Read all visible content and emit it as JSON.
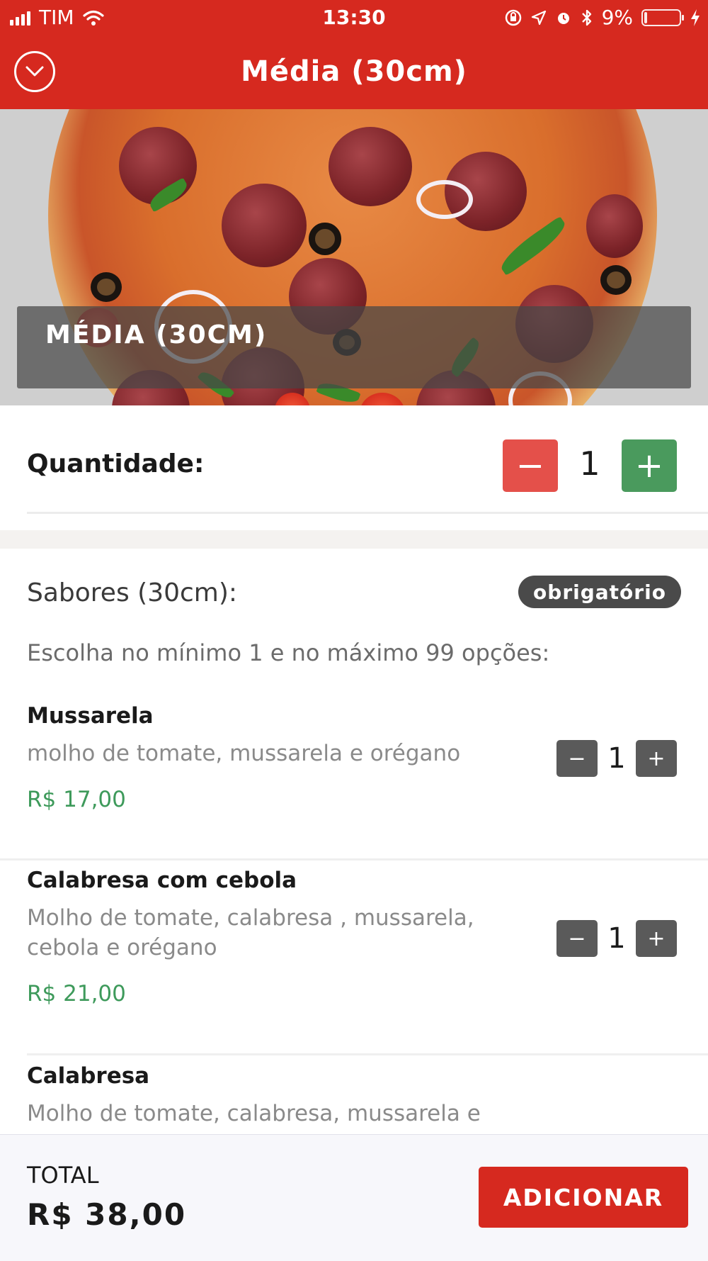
{
  "status_bar": {
    "carrier": "TIM",
    "time": "13:30",
    "battery_percent": "9%",
    "battery_level": 0.09,
    "icons": [
      "signal-icon",
      "wifi-icon",
      "orientation-lock-icon",
      "location-icon",
      "alarm-icon",
      "bluetooth-icon",
      "battery-icon",
      "charging-icon"
    ]
  },
  "nav": {
    "title": "Média (30cm)",
    "back_icon": "chevron-down-circle-icon"
  },
  "hero": {
    "label": "MÉDIA (30CM)"
  },
  "quantity": {
    "label": "Quantidade:",
    "value": "1",
    "minus": "−",
    "plus": "+",
    "minus_color": "#e4504a",
    "plus_color": "#4a9a5d"
  },
  "flavors": {
    "title": "Sabores (30cm):",
    "badge": "obrigatório",
    "instruction": "Escolha no mínimo 1 e no máximo 99 opções:",
    "items": [
      {
        "name": "Mussarela",
        "description": "molho de tomate, mussarela e orégano",
        "price": "R$ 17,00",
        "quantity": "1",
        "minus": "−",
        "plus": "+"
      },
      {
        "name": "Calabresa com cebola",
        "description": "Molho de tomate, calabresa , mussarela, cebola e orégano",
        "price": "R$ 21,00",
        "quantity": "1",
        "minus": "−",
        "plus": "+"
      },
      {
        "name": "Calabresa",
        "description": "Molho de tomate, calabresa, mussarela e"
      }
    ]
  },
  "footer": {
    "total_label": "TOTAL",
    "total_value": "R$ 38,00",
    "add_button": "ADICIONAR"
  },
  "colors": {
    "brand_red": "#d6291f",
    "price_green": "#3e9a5b",
    "badge_dark": "#4a4a4a"
  }
}
